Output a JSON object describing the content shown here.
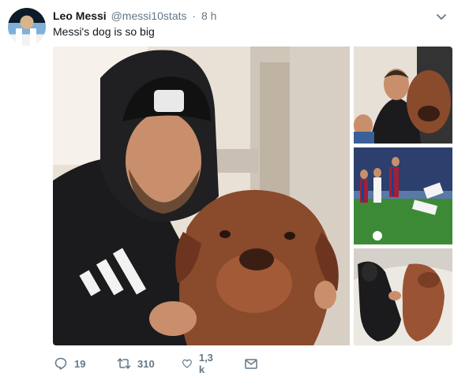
{
  "tweet": {
    "display_name": "Leo Messi",
    "handle": "@messi10stats",
    "separator": "·",
    "time": "8 h",
    "text": "Messi's dog is so big"
  },
  "media": {
    "photos": [
      "messi-with-dog-main",
      "messi-dog-side-1",
      "messi-football-match",
      "person-lying-with-dog"
    ]
  },
  "actions": {
    "reply_count": "19",
    "retweet_count": "310",
    "like_count": "1,3 k"
  },
  "icons": {
    "reply": "reply-icon",
    "retweet": "retweet-icon",
    "like": "heart-icon",
    "dm": "envelope-icon",
    "more": "chevron-down-icon"
  },
  "colors": {
    "text_primary": "#14171a",
    "text_secondary": "#657786"
  }
}
